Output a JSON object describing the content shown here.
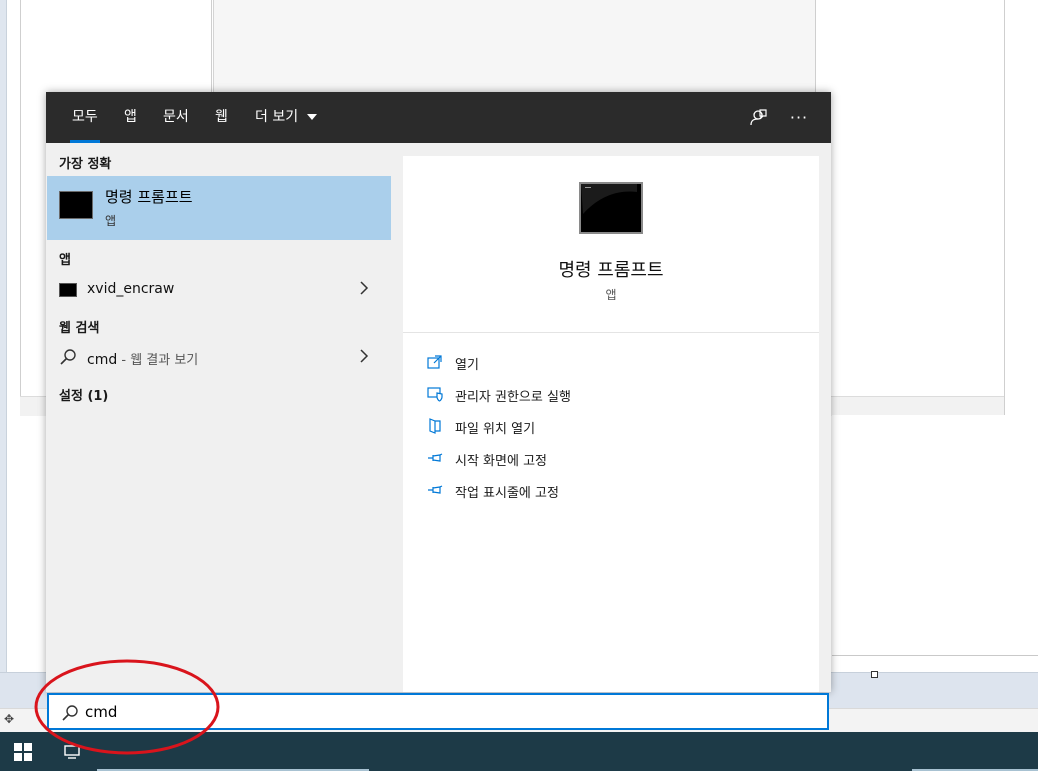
{
  "tabs": [
    {
      "label": "모두"
    },
    {
      "label": "앱"
    },
    {
      "label": "문서"
    },
    {
      "label": "웹"
    },
    {
      "label": "더 보기"
    }
  ],
  "toolbar_icons": [
    "feedback-icon",
    "more-options-icon"
  ],
  "more_label": "···",
  "best_match": {
    "heading": "가장 정확",
    "title": "명령 프롬프트",
    "subtitle": "앱"
  },
  "apps": {
    "heading": "앱",
    "items": [
      {
        "label": "xvid_encraw"
      }
    ]
  },
  "web": {
    "heading": "웹 검색",
    "query": "cmd",
    "suffix": " - 웹 결과 보기"
  },
  "settings": {
    "heading": "설정 (1)"
  },
  "detail": {
    "title": "명령 프롬프트",
    "subtitle": "앱",
    "actions": [
      {
        "label": "열기",
        "icon": "open-icon"
      },
      {
        "label": "관리자 권한으로 실행",
        "icon": "admin-shield-icon"
      },
      {
        "label": "파일 위치 열기",
        "icon": "file-location-icon"
      },
      {
        "label": "시작 화면에 고정",
        "icon": "pin-icon"
      },
      {
        "label": "작업 표시줄에 고정",
        "icon": "pin-icon"
      }
    ]
  },
  "search": {
    "value": "cmd"
  },
  "colors": {
    "accent": "#0078d7",
    "selected": "#aacfeb",
    "topbar": "#2b2b2b",
    "taskbar": "#1d3a47",
    "annotation": "#d9141c"
  }
}
